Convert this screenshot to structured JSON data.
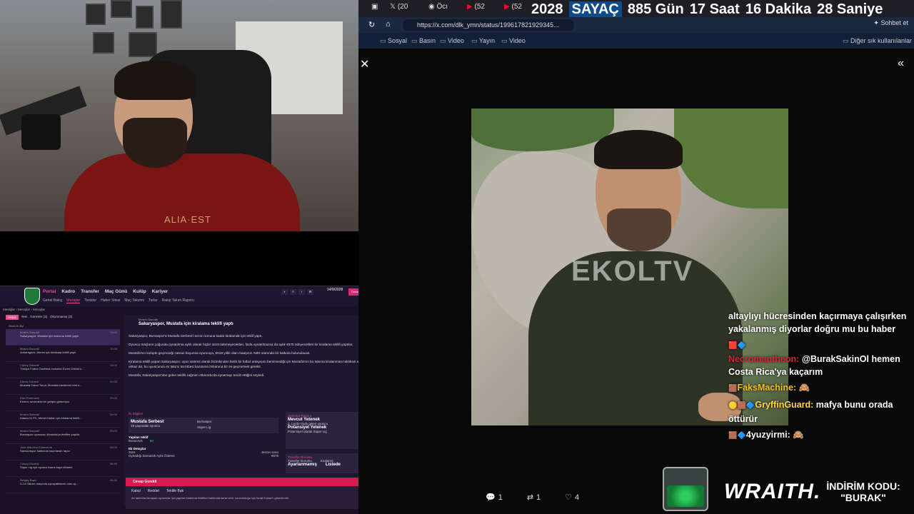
{
  "game": {
    "nav": [
      "Portal",
      "Kadro",
      "Transfer",
      "Maç Günü",
      "Kulüp",
      "Kariyer"
    ],
    "subnav": [
      "Genel Bakış",
      "Mesajlar",
      "Tesisler",
      "Haber Sitesi",
      "Maç Takvimi",
      "Turlar",
      "Rakip Takım Raporu"
    ],
    "date": "14/9/2028",
    "continue": "Devam",
    "crumb": "Mesajlar › Mesajlar › Mesajlar",
    "inbox_tabs": [
      "Hepsi",
      "Yeni",
      "Görevler (3)",
      "Okunmamış (3)"
    ],
    "inbox_head": "Günü Ki Eyl",
    "messages": [
      {
        "from": "Mosim Savcıdil",
        "text": "Sakaryaspor, Mustafa için kiralama teklifi yaptı",
        "time": "10:02"
      },
      {
        "from": "Mosim Savcıdil",
        "text": "Ankaragücü, Ahmet için kiralama teklifi yaptı",
        "time": "10:00"
      },
      {
        "from": "Cüney Güvenli",
        "text": "Türkiye Futbol Gazetesi muhabiri Evren Öztürk'ü...",
        "time": "09:00"
      },
      {
        "from": "Cüney Güvenli",
        "text": "Mustafa Cabul Torun, Mustafa transferini rafo k...",
        "time": "09:00"
      },
      {
        "from": "Ekin Rotemanz",
        "text": "Kerem, sevindirici bir gelişim gösteriyor",
        "time": "09:00"
      },
      {
        "from": "Mosim Savcıdil",
        "text": "Adana 01 FK, Ahmet Hakan için kiralama teklifi...",
        "time": "09:00"
      },
      {
        "from": "Mosim Savcıdil",
        "text": "Bursaspor oyuncusu Mustafa'ya teklifler yapıldı",
        "time": "09:00"
      },
      {
        "from": "Juan Mauricio Echeverrie",
        "text": "Samsunspor hakkında hazırlanan rapor",
        "time": "09:00"
      },
      {
        "from": "Cüney Güvenli",
        "text": "Süper Lig için oyuncu lisans kayıt dönemi",
        "time": "08:49"
      },
      {
        "from": "Sergey Bayk",
        "text": "U-19 Takımı maçında oynayabilecek olan oy...",
        "time": "08:49"
      }
    ],
    "detail": {
      "from": "Mosim Savcıdil",
      "title": "Sakaryaspor, Mustafa için kiralama teklifi yaptı",
      "time": "10:02",
      "paragraphs": [
        "Sakaryaspor, Bursaspor'a Mustafa Serbest'i sezon sonuna kadar kiralamak için teklif yaptı.",
        "Oyuncu maçların çoğunda oynatılırsa aylık olarak hiçbir ücret ödemeyecekleri, fazla oynatılmazsa da aylık €575 ödeyecekleri bir kiralama teklifi yaptılar.",
        "Mustafa'nın kulüpte geçireceği zaman boyunca oyuncuya, €818 yıllık olan maaşının %80 oranında bir katkıda bulunulacak.",
        "Kiralama teklifi yapan Sakaryaspor, oyun sistemi olarak bizimkinden farklı bir futbol anlayışını benimsediği için Mustafa'nın bu takıma kiralanması taktiksel açıdan faydalı olmaz da, bu oyuncunun es takımı tecrübesi kazanma imkanına bir es geçmemek gerekir.",
        "Mustafa, Sakaryaspor'dan gelen teklife rağmen Altınordu'da oynamayı tercih ettiğini söyledi."
      ],
      "player_label": "İlk Bilgileri",
      "player_name": "Mustafa Serbest",
      "player_sub": "19 yaşındaki oyuncu",
      "club": "Bursaspor",
      "league": "Süper Lig",
      "offer_label": "Yapılan teklif",
      "offer_row": "Bonservis",
      "offer_val": "€0",
      "extra_label": "Ek Detaylar",
      "extra_row1": "Süre",
      "extra_val1": "Sezon sonu",
      "extra_row2": "Oynadığı Zamanlık Aylık Ödeme",
      "extra_val2": "€575",
      "rep_label": "Antrenör Raporu",
      "current": "Mevcut Yetenek",
      "current_sub": "2. Lig'de önde gelen oyuncu",
      "potential": "Potansiyel Yetenek",
      "potential_sub": "Potansiyel olarak Süper Lig",
      "status_label": "Transfer Durumu",
      "status1_k": "Transfer Durumu",
      "status1_v": "Ayarlanmamış",
      "status2_k": "Kiralama",
      "status2_v": "Listede",
      "response_bar": "Cevap Gerekli",
      "accept": "Kabul",
      "reject": "Reddet",
      "negotiate": "Teklife Bak",
      "note": "Az takımda olmayan oyuncular için yapılan kiralama teklifleri hakkında karar verir. sorumluluğu için İsrael Kakari'ı görevlendir"
    }
  },
  "browser": {
    "tabs": [
      "(20",
      "Öcı",
      "(52",
      "(52"
    ],
    "counter": {
      "year": "2028",
      "label": "SAYAÇ",
      "days": "885 Gün",
      "hours": "17 Saat",
      "minutes": "16 Dakika",
      "seconds": "28 Saniye"
    },
    "url": "https://x.com/dlk_ymn/status/19961782192934​5...",
    "bookmarks": [
      "Sosyal",
      "Basın",
      "Video",
      "Yayın",
      "Video"
    ],
    "bookmarks_right": "Diğer sık kullanılanlar",
    "sohbet": "Sohbet et",
    "photo_watermark": "EKOLTV",
    "actions": {
      "replies": "1",
      "reposts": "1",
      "likes": "4"
    }
  },
  "chat": [
    {
      "user": "",
      "text": "altaylıyı hücresinden kaçırmaya çalışırken yakalanmış diyorlar doğru mu bu haber"
    },
    {
      "user": "Necromantheon:",
      "text": "@BurakSakinOl hemen Costa Rica'ya kaçarım"
    },
    {
      "user": "FaksMachine:",
      "text": "🙈"
    },
    {
      "user": "GryffinGuard:",
      "text": "mafya bunu orada öttürür"
    },
    {
      "user": "4yuzyirmi:",
      "text": "🙈"
    }
  ],
  "sponsor": {
    "brand": "WRAITH.",
    "promo1": "İNDİRİM KODU:",
    "promo2": "\"BURAK\""
  }
}
